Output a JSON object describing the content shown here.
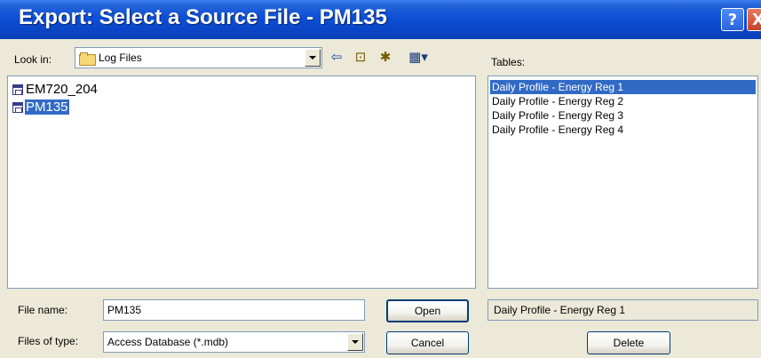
{
  "window": {
    "title": "Export: Select a Source File - PM135",
    "help_glyph": "?",
    "close_glyph": "X"
  },
  "lookin": {
    "label": "Look in:",
    "value": "Log Files",
    "tools": [
      {
        "icon": "back-arrow-icon",
        "glyph": "⇦"
      },
      {
        "icon": "up-folder-icon",
        "glyph": "⊡"
      },
      {
        "icon": "new-folder-icon",
        "glyph": "✱"
      },
      {
        "icon": "view-menu-icon",
        "glyph": "▦▾"
      }
    ]
  },
  "files": {
    "items": [
      {
        "name": "EM720_204",
        "selected": false
      },
      {
        "name": "PM135",
        "selected": true
      }
    ]
  },
  "tables": {
    "label": "Tables:",
    "items": [
      {
        "name": "Daily Profile - Energy Reg 1",
        "selected": true
      },
      {
        "name": "Daily Profile - Energy Reg 2",
        "selected": false
      },
      {
        "name": "Daily Profile - Energy Reg 3",
        "selected": false
      },
      {
        "name": "Daily Profile - Energy Reg 4",
        "selected": false
      }
    ],
    "selected_display": "Daily Profile - Energy Reg 1",
    "delete_label": "Delete"
  },
  "form": {
    "file_name_label": "File name:",
    "file_name_value": "PM135",
    "file_type_label": "Files of type:",
    "file_type_value": "Access Database (*.mdb)",
    "open_label": "Open",
    "cancel_label": "Cancel"
  },
  "colors": {
    "titlebar": "#0a46c8",
    "selection": "#316ac5",
    "dialog_bg": "#ece9d8"
  }
}
